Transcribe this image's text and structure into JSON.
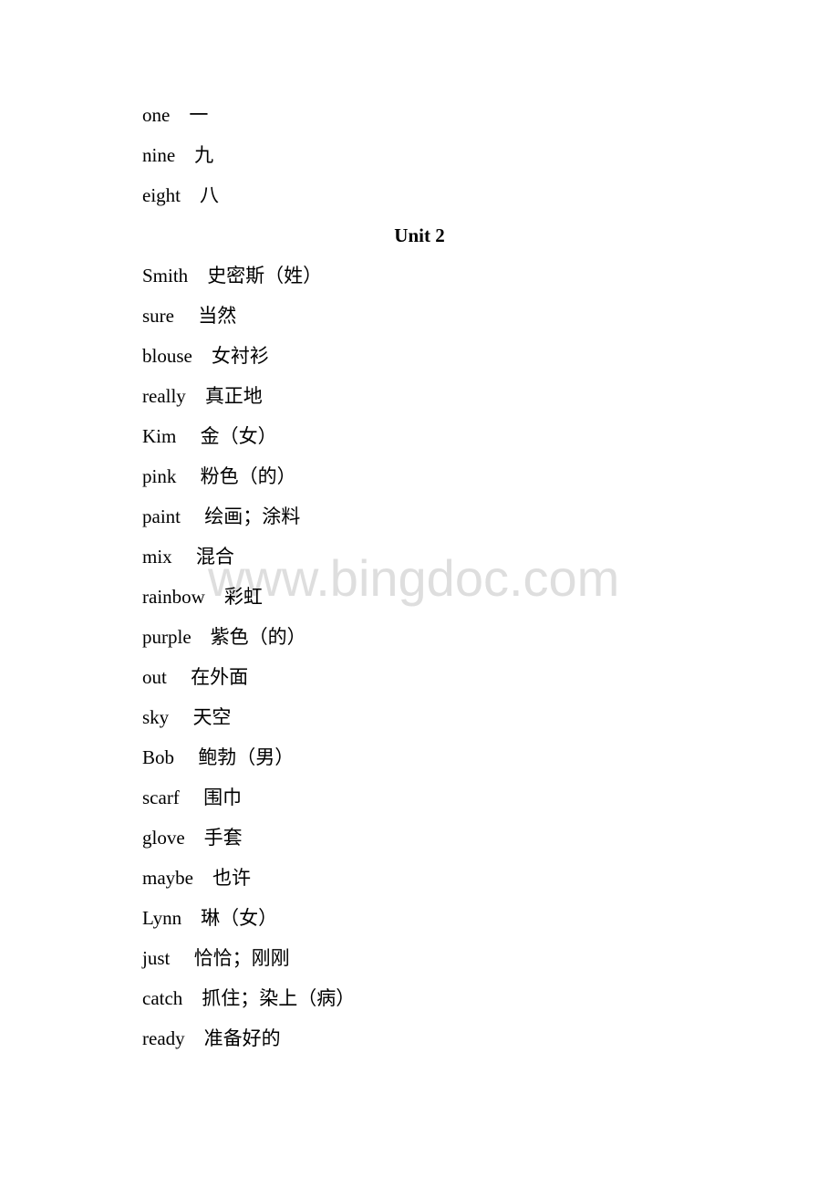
{
  "document": {
    "section_before": [
      {
        "en": "one",
        "zh": "一",
        "gap": "    "
      },
      {
        "en": "nine",
        "zh": "九",
        "gap": "    "
      },
      {
        "en": "eight",
        "zh": "八",
        "gap": "    "
      }
    ],
    "unit_title": "Unit 2",
    "unit2_entries": [
      {
        "en": "Smith",
        "zh": "史密斯（姓）",
        "gap": "    "
      },
      {
        "en": "sure",
        "zh": "当然",
        "gap": "     "
      },
      {
        "en": "blouse",
        "zh": "女衬衫",
        "gap": "    "
      },
      {
        "en": "really",
        "zh": "真正地",
        "gap": "    "
      },
      {
        "en": "Kim",
        "zh": "金（女）",
        "gap": "     "
      },
      {
        "en": "pink",
        "zh": "粉色（的）",
        "gap": "     "
      },
      {
        "en": "paint",
        "zh": "绘画；涂料",
        "gap": "     "
      },
      {
        "en": "mix",
        "zh": "混合",
        "gap": "     "
      },
      {
        "en": "rainbow",
        "zh": "彩虹",
        "gap": "    "
      },
      {
        "en": "purple",
        "zh": "紫色（的）",
        "gap": "    "
      },
      {
        "en": "out",
        "zh": "在外面",
        "gap": "     "
      },
      {
        "en": "sky",
        "zh": "天空",
        "gap": "     "
      },
      {
        "en": "Bob",
        "zh": "鲍勃（男）",
        "gap": "     "
      },
      {
        "en": "scarf",
        "zh": "围巾",
        "gap": "     "
      },
      {
        "en": "glove",
        "zh": "手套",
        "gap": "    "
      },
      {
        "en": "maybe",
        "zh": "也许",
        "gap": "    "
      },
      {
        "en": "Lynn",
        "zh": "琳（女）",
        "gap": "    "
      },
      {
        "en": "just",
        "zh": "恰恰；刚刚",
        "gap": "     "
      },
      {
        "en": "catch",
        "zh": "抓住；染上（病）",
        "gap": "    "
      },
      {
        "en": "ready",
        "zh": "准备好的",
        "gap": "    "
      }
    ]
  },
  "watermark": {
    "text": "www.bingdoc.com",
    "color": "#d9d9d9"
  }
}
